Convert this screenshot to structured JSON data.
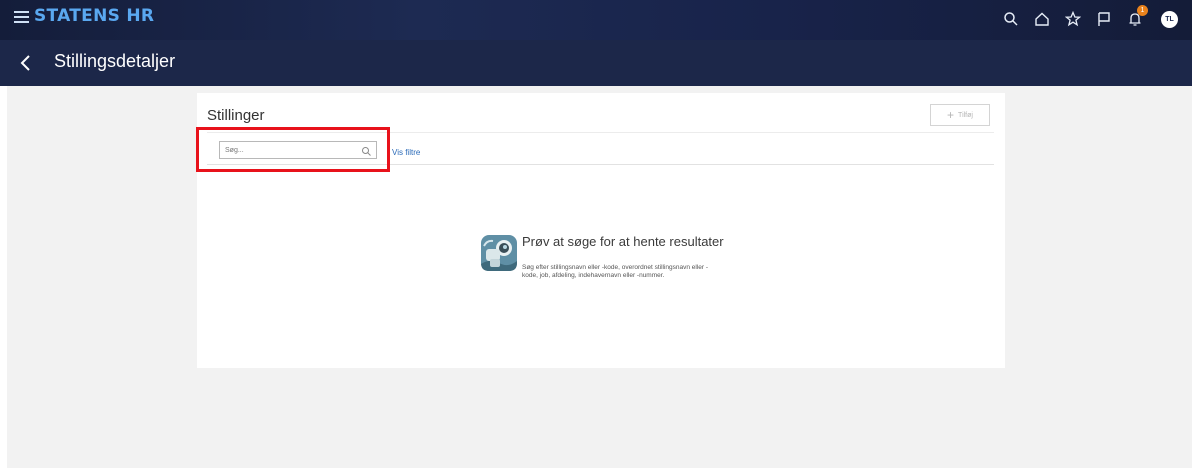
{
  "app": {
    "brand": "STATENS HR"
  },
  "header": {
    "icons": [
      "search-icon",
      "home-icon",
      "star-icon",
      "flag-icon",
      "bell-icon"
    ],
    "notification_count": "1",
    "avatar_initials": "TL",
    "brand_color": "#5aa8f0"
  },
  "subheader": {
    "title": "Stillingsdetaljer",
    "back_icon": "chevron-left-icon"
  },
  "card": {
    "title": "Stillinger",
    "add_label": "Tilføj",
    "search_placeholder": "Søg...",
    "filters_link": "Vis filtre"
  },
  "empty_state": {
    "icon": "binoculars-icon",
    "title": "Prøv at søge for at hente resultater",
    "description": "Søg efter stillingsnavn eller -kode, overordnet stillingsnavn eller -kode, job, afdeling, indehavernavn eller -nummer."
  },
  "annotation": {
    "color": "#e8121b"
  }
}
